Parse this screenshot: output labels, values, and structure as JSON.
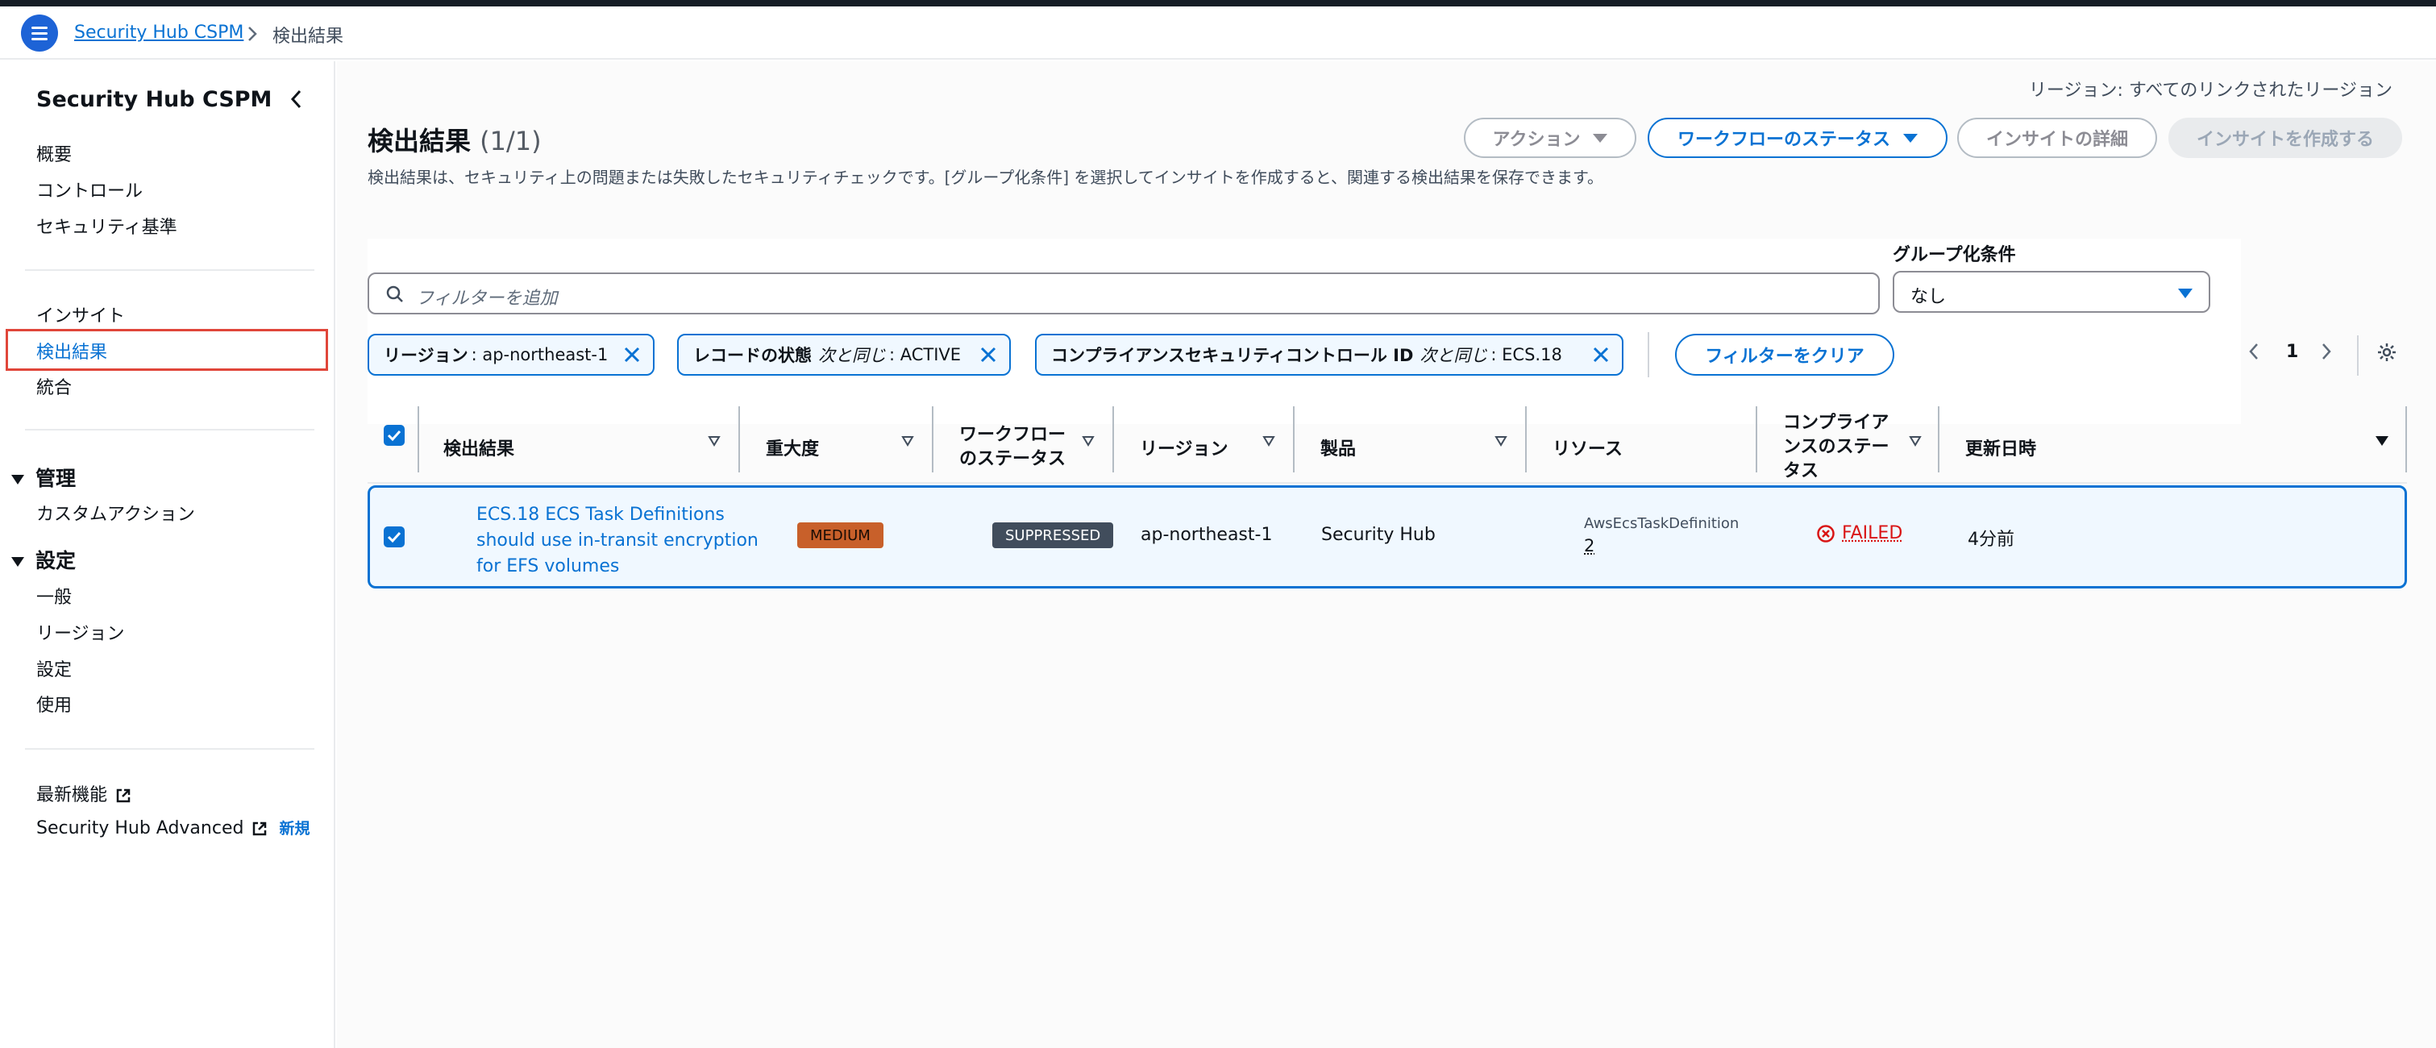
{
  "breadcrumb": {
    "root": "Security Hub CSPM",
    "current": "検出結果"
  },
  "sidebar": {
    "title": "Security Hub CSPM",
    "group1": [
      "概要",
      "コントロール",
      "セキュリティ基準"
    ],
    "group2": [
      "インサイト",
      "検出結果",
      "統合"
    ],
    "active_item": "検出結果",
    "section_manage": {
      "label": "管理",
      "items": [
        "カスタムアクション"
      ]
    },
    "section_settings": {
      "label": "設定",
      "items": [
        "一般",
        "リージョン",
        "設定",
        "使用"
      ]
    },
    "links": {
      "whats_new": "最新機能",
      "advanced": "Security Hub Advanced",
      "new_badge": "新規"
    }
  },
  "main": {
    "region_note": "リージョン: すべてのリンクされたリージョン",
    "title": "検出結果",
    "count": "(1/1)",
    "description": "検出結果は、セキュリティ上の問題または失敗したセキュリティチェックです。[グループ化条件] を選択してインサイトを作成すると、関連する検出結果を保存できます。",
    "buttons": {
      "actions": "アクション",
      "workflow_status": "ワークフローのステータス",
      "insight_details": "インサイトの詳細",
      "create_insight": "インサイトを作成する"
    },
    "search": {
      "placeholder": "フィルターを追加"
    },
    "group_by": {
      "label": "グループ化条件",
      "value": "なし"
    },
    "tokens": [
      {
        "key": "リージョン",
        "op": "",
        "value": ": ap-northeast-1"
      },
      {
        "key": "レコードの状態",
        "op": "次と同じ",
        "value": ": ACTIVE"
      },
      {
        "key": "コンプライアンスセキュリティコントロール ID",
        "op": "次と同じ",
        "value": ": ECS.18"
      }
    ],
    "clear_filters": "フィルターをクリア",
    "pagination": {
      "page": "1"
    },
    "table": {
      "headers": {
        "finding": "検出結果",
        "severity": "重大度",
        "workflow": "ワークフローのステータス",
        "region": "リージョン",
        "product": "製品",
        "resource": "リソース",
        "compliance": "コンプライアンスのステータス",
        "updated": "更新日時"
      },
      "rows": [
        {
          "finding": "ECS.18 ECS Task Definitions should use in-transit encryption for EFS volumes",
          "severity": "MEDIUM",
          "workflow": "SUPPRESSED",
          "region": "ap-northeast-1",
          "product": "Security Hub",
          "resource_type": "AwsEcsTaskDefinition",
          "resource_count": "2",
          "compliance": "FAILED",
          "updated": "4分前"
        }
      ]
    }
  },
  "colors": {
    "accent": "#0972d3",
    "failed": "#d91515",
    "medium": "#c8602a",
    "suppressed": "#414d5c",
    "highlight": "#e0463a"
  }
}
